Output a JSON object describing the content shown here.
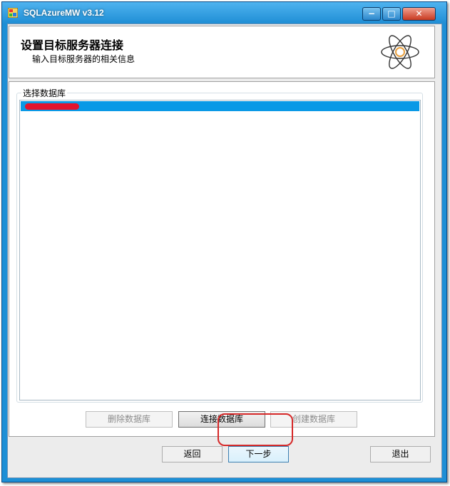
{
  "window": {
    "title": "SQLAzureMW v3.12",
    "caption_min": "−",
    "caption_max": "□",
    "caption_close": "✕"
  },
  "header": {
    "title": "设置目标服务器连接",
    "subtitle": "输入目标服务器的相关信息",
    "logo_icon": "atom-icon"
  },
  "database_group": {
    "label": "选择数据库",
    "items": [
      {
        "label": "",
        "selected": true
      }
    ]
  },
  "db_buttons": {
    "delete": "删除数据库",
    "connect": "连接数据库",
    "create": "创建数据库"
  },
  "nav_buttons": {
    "back": "返回",
    "next": "下一步",
    "exit": "退出"
  },
  "colors": {
    "titlebar": "#1f8ed5",
    "selection": "#0a99e6",
    "annotation": "#d62828",
    "redaction": "#e3142e"
  }
}
